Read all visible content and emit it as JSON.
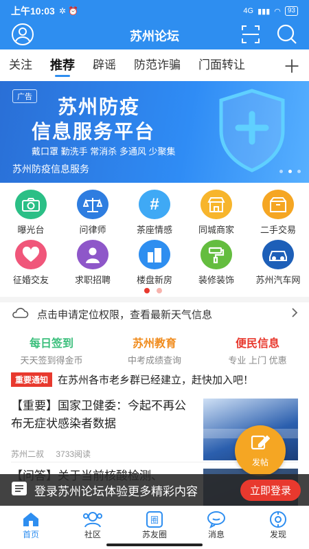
{
  "status": {
    "time": "上午10:03",
    "net": "4G",
    "battery": "93"
  },
  "header": {
    "title": "苏州论坛",
    "avatar_icon": "user-avatar-icon",
    "scan_icon": "scan-icon",
    "search_icon": "search-icon"
  },
  "tabs": [
    {
      "label": "关注"
    },
    {
      "label": "推荐",
      "active": true
    },
    {
      "label": "辟谣"
    },
    {
      "label": "防范诈骗"
    },
    {
      "label": "门面转让"
    }
  ],
  "banner": {
    "ad_label": "广告",
    "line1": "苏州防疫",
    "line2": "信息服务平台",
    "slogan": "戴口罩 勤洗手 常消杀 多通风 少聚集",
    "caption": "苏州防疫信息服务",
    "slide_index": 2,
    "slide_count": 3
  },
  "grid": [
    {
      "label": "曝光台",
      "icon": "camera-icon",
      "color": "#2bbf86"
    },
    {
      "label": "问律师",
      "icon": "scales-icon",
      "color": "#2e7de0"
    },
    {
      "label": "茶座情感",
      "icon": "hashtag-icon",
      "color": "#3fa9f5"
    },
    {
      "label": "同城商家",
      "icon": "store-icon",
      "color": "#f7b52c"
    },
    {
      "label": "二手交易",
      "icon": "box-icon",
      "color": "#f5a623"
    },
    {
      "label": "征婚交友",
      "icon": "heart-icon",
      "color": "#f0567a"
    },
    {
      "label": "求职招聘",
      "icon": "person-icon",
      "color": "#8e57c9"
    },
    {
      "label": "楼盘新房",
      "icon": "buildings-icon",
      "color": "#2e8ef0"
    },
    {
      "label": "装修装饰",
      "icon": "paint-roller-icon",
      "color": "#64bd3f"
    },
    {
      "label": "苏州汽车网",
      "icon": "car-icon",
      "color": "#1d5fb8"
    }
  ],
  "grid_pager": {
    "page": 1,
    "pages": 2
  },
  "weather": {
    "text": "点击申请定位权限，查看最新天气信息"
  },
  "shortcuts": [
    {
      "title": "每日签到",
      "sub": "天天签到得金币",
      "color": "#3bbf7c"
    },
    {
      "title": "苏州教育",
      "sub": "中考成绩查询",
      "color": "#f08c1e"
    },
    {
      "title": "便民信息",
      "sub": "专业 上门 优惠",
      "color": "#e8392e"
    }
  ],
  "notice": {
    "badge": "重要通知",
    "text": "在苏州各市老乡群已经建立，赶快加入吧！"
  },
  "articles": [
    {
      "title": "【重要】国家卫健委：今起不再公布无症状感染者数据",
      "author": "苏州二叔",
      "reads": "3733阅读"
    },
    {
      "title": "【问答】关于当前核酸检测、"
    }
  ],
  "fab": {
    "label": "发帖"
  },
  "login_bar": {
    "text": "登录苏州论坛体验更多精彩内容",
    "button": "立即登录"
  },
  "bottom_nav": [
    {
      "label": "首页",
      "icon": "home-icon",
      "active": true
    },
    {
      "label": "社区",
      "icon": "community-icon"
    },
    {
      "label": "苏友圈",
      "icon": "circle-icon"
    },
    {
      "label": "消息",
      "icon": "message-icon"
    },
    {
      "label": "发现",
      "icon": "discover-icon"
    }
  ],
  "colors": {
    "brand": "#2e8ef0",
    "accent": "#e8392e"
  }
}
